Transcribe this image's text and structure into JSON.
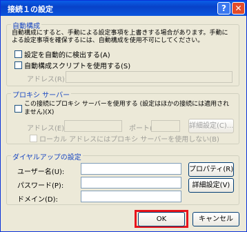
{
  "window": {
    "title": "接続１の設定",
    "help_glyph": "?",
    "close_glyph": "✕"
  },
  "auto": {
    "legend": "自動構成",
    "description": "自動構成にすると、手動による設定事項を上書きする場合があります。手動による設定事項を確保するには、自動構成を使用不可にしてください。",
    "detect_label": "設定を自動的に検出する(A)",
    "script_label": "自動構成スクリプトを使用する(S)",
    "address_label": "アドレス(R):",
    "address_value": ""
  },
  "proxy": {
    "legend": "プロキシ サーバー",
    "use_label": "この接続にプロキシ サーバーを使用する (設定はほかの接続には適用されません)(X)",
    "address_label": "アドレス(E):",
    "port_label": "ポート(T):",
    "advanced_label": "詳細設定(C)...",
    "bypass_label": "ローカル アドレスにはプロキシ サーバーを使用しない(B)"
  },
  "dialup": {
    "legend": "ダイヤルアップの設定",
    "user_label": "ユーザー名(U):",
    "password_label": "パスワード(P):",
    "domain_label": "ドメイン(D):",
    "properties_label": "プロパティ(R)",
    "advanced_label": "詳細設定(V)"
  },
  "footer": {
    "ok_label": "OK",
    "cancel_label": "キャンセル"
  }
}
